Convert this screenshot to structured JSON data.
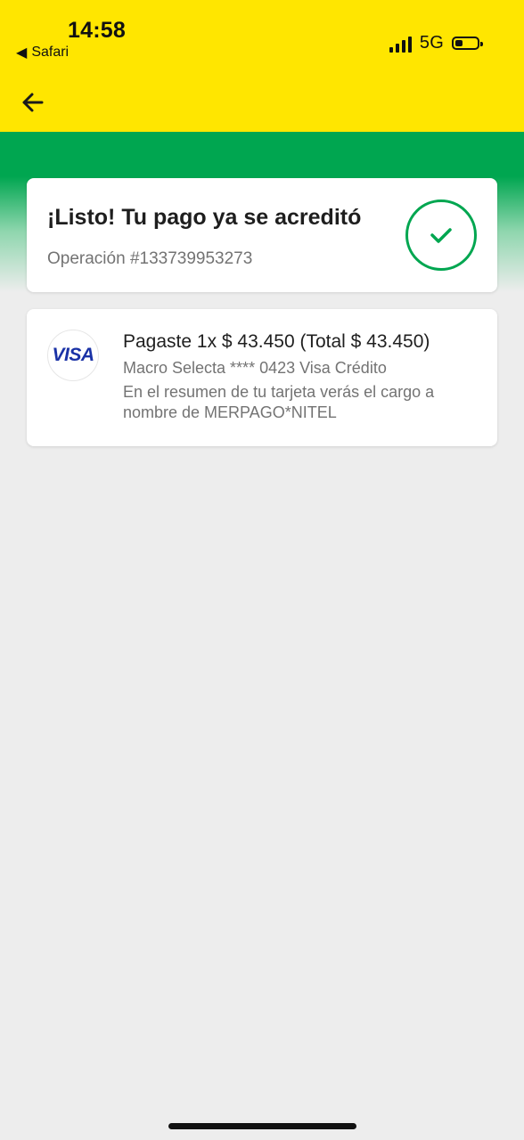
{
  "status_bar": {
    "time": "14:58",
    "back_app": "Safari",
    "back_glyph": "◀",
    "network": "5G",
    "signal_icon": "cellular-signal-icon",
    "battery_icon": "battery-icon"
  },
  "header": {
    "back_icon": "arrow-left-icon"
  },
  "success": {
    "title": "¡Listo! Tu pago ya se acreditó",
    "operation": "Operación #133739953273",
    "check_icon": "check-icon"
  },
  "payment": {
    "brand": "VISA",
    "summary": "Pagaste 1x $ 43.450 (Total $ 43.450)",
    "card": "Macro Selecta **** 0423 Visa Crédito",
    "note": "En el resumen de tu tarjeta verás el cargo a nombre de MERPAGO*NITEL"
  },
  "colors": {
    "header_yellow": "#ffe600",
    "success_green": "#00a650",
    "background": "#ededed",
    "visa_blue": "#1a32a6"
  }
}
